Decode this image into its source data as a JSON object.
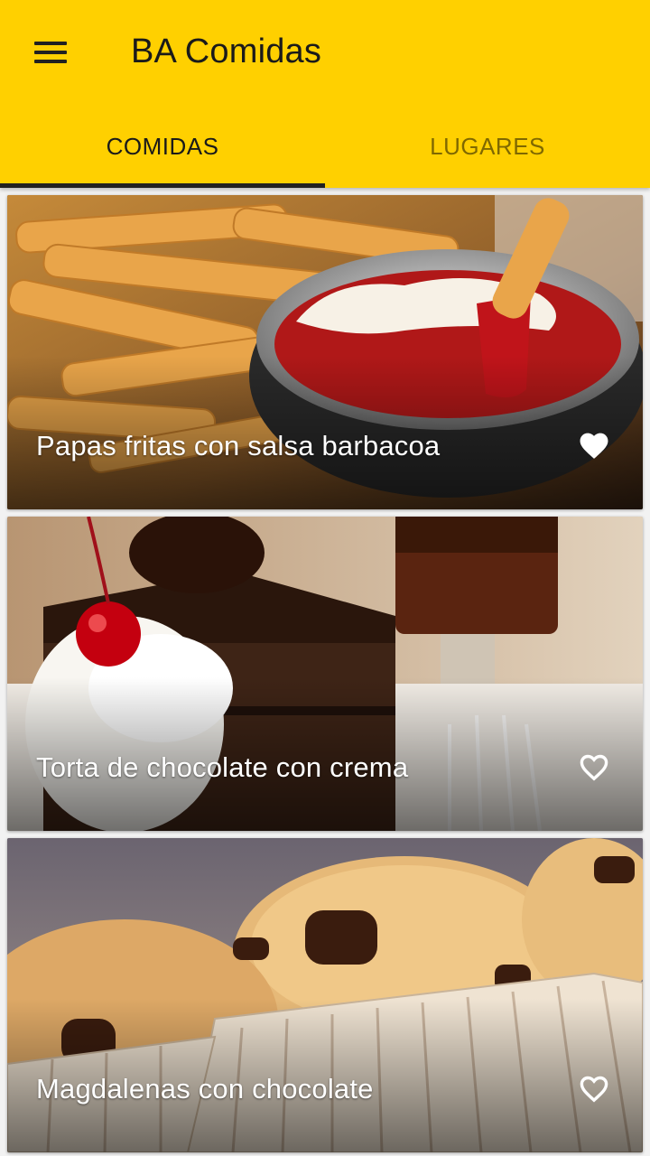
{
  "app": {
    "title": "BA Comidas",
    "accent_color": "#FFD000",
    "menu_icon": "hamburger-menu-icon"
  },
  "tabs": [
    {
      "label": "COMIDAS",
      "selected": true
    },
    {
      "label": "LUGARES",
      "selected": false
    }
  ],
  "cards": [
    {
      "title": "Papas fritas con salsa barbacoa",
      "favorite": true,
      "image": "french fries with ketchup dip"
    },
    {
      "title": "Torta de chocolate con crema",
      "favorite": false,
      "image": "chocolate cake slice with whipped cream and cherry"
    },
    {
      "title": "Magdalenas con chocolate",
      "favorite": false,
      "image": "chocolate chip muffins"
    }
  ]
}
